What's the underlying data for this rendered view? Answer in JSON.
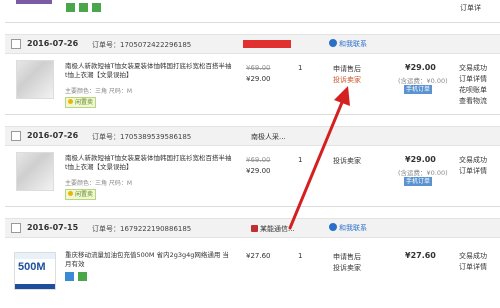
{
  "orders": [
    {
      "date": "2016-07-26",
      "order_no": "订单号：1705072422296185",
      "contact": "和我联系",
      "title": "南极人新款短袖T恤女装夏装体恤韩国打底衫宽松百搭半袖t恤上衣潮【文景误拍】",
      "attrs": "主要颜色：三角  尺码：M",
      "orig_price": "¥69.00",
      "price": "¥29.00",
      "qty": "1",
      "actions": [
        "申请售后",
        "投诉卖家"
      ],
      "total": "¥29.00",
      "fee": "(含运费：¥0.00)",
      "pay_badge": "手机订单",
      "status": [
        "交易成功",
        "订单详情",
        "花呗账单",
        "查看物流"
      ],
      "tag": "闲置卖"
    },
    {
      "date": "2016-07-26",
      "order_no": "订单号：1705389539586185",
      "shop": "南极人采...",
      "title": "南极人新款短袖T恤女装夏装体恤韩国打底衫宽松百搭半袖t恤上衣潮【文景误拍】",
      "attrs": "主要颜色：三角  尺码：M",
      "orig_price": "¥69.00",
      "price": "¥29.00",
      "qty": "1",
      "actions": [
        "投诉卖家"
      ],
      "total": "¥29.00",
      "fee": "(含运费：¥0.00)",
      "pay_badge": "手机订单",
      "status": [
        "交易成功",
        "订单详情"
      ],
      "tag": "闲置卖"
    },
    {
      "date": "2016-07-15",
      "order_no": "订单号：1679222190886185",
      "shop": "某能通信...",
      "contact": "和我联系",
      "title": "重庆移动流量加油包充值500M 省内2g3g4g网络通用 当月有效",
      "thumb_text": "500M",
      "price": "¥27.60",
      "qty": "1",
      "actions": [
        "申请售后",
        "投诉卖家"
      ],
      "total": "¥27.60",
      "status": [
        "交易成功",
        "订单详情"
      ]
    }
  ],
  "colors": {
    "arrow": "#d42020",
    "link_blue": "#2a6fc9",
    "badge": "#5b93d1"
  }
}
